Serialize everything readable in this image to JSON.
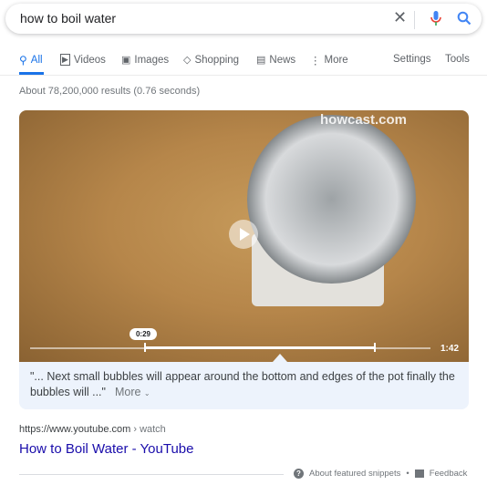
{
  "search": {
    "query": "how to boil water"
  },
  "tabs": [
    {
      "label": "All",
      "icon": "search-icon",
      "active": true
    },
    {
      "label": "Videos",
      "icon": "play-box-icon"
    },
    {
      "label": "Images",
      "icon": "image-icon"
    },
    {
      "label": "Shopping",
      "icon": "tag-icon"
    },
    {
      "label": "News",
      "icon": "newspaper-icon"
    },
    {
      "label": "More",
      "icon": "more-vert-icon"
    }
  ],
  "tools": {
    "settings": "Settings",
    "tools": "Tools"
  },
  "stats": "About 78,200,000 results (0.76 seconds)",
  "video": {
    "watermark": "howcast.com",
    "current_time": "0:29",
    "duration": "1:42",
    "segment_end_fraction": 0.82
  },
  "snippet": {
    "text": "\"... Next small bubbles will appear around the bottom and edges of the pot finally the bubbles will ...\"",
    "more": "More"
  },
  "result": {
    "url": "https://www.youtube.com",
    "crumb": "› watch",
    "title": "How to Boil Water - YouTube"
  },
  "footer": {
    "about": "About featured snippets",
    "sep": "•",
    "feedback": "Feedback"
  },
  "colors": {
    "accent": "#1a73e8",
    "link": "#1a0dab",
    "snippet_bg": "#edf3fc"
  }
}
